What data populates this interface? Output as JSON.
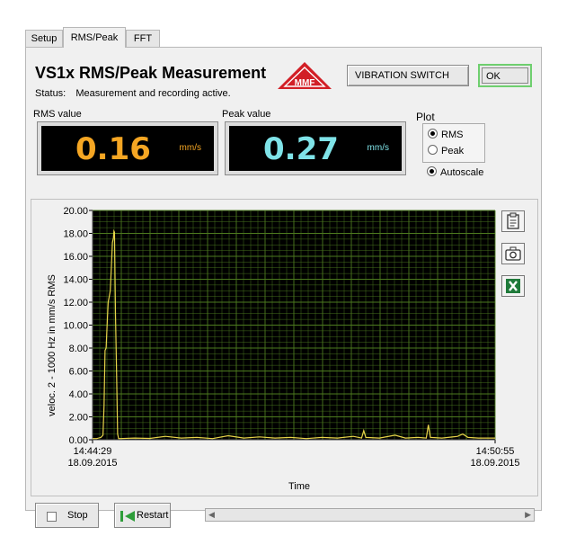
{
  "tabs": [
    {
      "label": "Setup",
      "active": false
    },
    {
      "label": "RMS/Peak",
      "active": true
    },
    {
      "label": "FFT",
      "active": false
    }
  ],
  "header": {
    "title": "VS1x RMS/Peak Measurement",
    "status_label": "Status:",
    "status_text": "Measurement and recording active.",
    "logo_text": "MMF",
    "vibration_switch_label": "VIBRATION SWITCH",
    "ok_label": "OK"
  },
  "rms": {
    "label": "RMS value",
    "value": "0.16",
    "unit": "mm/s",
    "color": "#f5a623"
  },
  "peak": {
    "label": "Peak value",
    "value": "0.27",
    "unit": "mm/s",
    "color": "#7fe3e8"
  },
  "plot": {
    "label": "Plot",
    "options": [
      {
        "label": "RMS",
        "selected": true
      },
      {
        "label": "Peak",
        "selected": false
      }
    ],
    "autoscale_label": "Autoscale",
    "autoscale_checked": true
  },
  "chart_data": {
    "type": "line",
    "xlabel": "Time",
    "ylabel": "veloc. 2 - 1000 Hz in mm/s RMS",
    "ylim": [
      0,
      20
    ],
    "yticks": [
      "0.00",
      "2.00",
      "4.00",
      "6.00",
      "8.00",
      "10.00",
      "12.00",
      "14.00",
      "16.00",
      "18.00",
      "20.00"
    ],
    "xticks": [
      {
        "time": "14:44:29",
        "date": "18.09.2015"
      },
      {
        "time": "14:50:55",
        "date": "18.09.2015"
      }
    ],
    "xlim_seconds": [
      0,
      386
    ],
    "grid": true,
    "colors": {
      "background": "#000000",
      "grid": "#4d7a1f",
      "line": "#e8d44a"
    },
    "series": [
      {
        "values": [
          [
            0,
            0.1
          ],
          [
            4,
            0.1
          ],
          [
            8,
            0.2
          ],
          [
            10,
            0.4
          ],
          [
            11,
            3
          ],
          [
            12,
            7.8
          ],
          [
            13,
            8.0
          ],
          [
            14,
            10
          ],
          [
            15,
            12
          ],
          [
            16,
            12.5
          ],
          [
            17,
            13
          ],
          [
            18,
            15
          ],
          [
            19,
            17.2
          ],
          [
            20,
            17.6
          ],
          [
            20.5,
            18.2
          ],
          [
            21,
            18.1
          ],
          [
            22,
            11
          ],
          [
            23,
            6
          ],
          [
            24,
            0.5
          ],
          [
            25,
            0.1
          ],
          [
            26,
            0.1
          ],
          [
            40,
            0.15
          ],
          [
            55,
            0.12
          ],
          [
            70,
            0.3
          ],
          [
            85,
            0.15
          ],
          [
            100,
            0.2
          ],
          [
            115,
            0.1
          ],
          [
            130,
            0.35
          ],
          [
            145,
            0.15
          ],
          [
            160,
            0.25
          ],
          [
            175,
            0.15
          ],
          [
            190,
            0.2
          ],
          [
            205,
            0.1
          ],
          [
            220,
            0.2
          ],
          [
            235,
            0.15
          ],
          [
            250,
            0.3
          ],
          [
            258,
            0.15
          ],
          [
            260,
            0.8
          ],
          [
            262,
            0.2
          ],
          [
            275,
            0.15
          ],
          [
            290,
            0.4
          ],
          [
            300,
            0.15
          ],
          [
            312,
            0.2
          ],
          [
            320,
            0.15
          ],
          [
            322,
            1.3
          ],
          [
            324,
            0.2
          ],
          [
            335,
            0.15
          ],
          [
            350,
            0.3
          ],
          [
            355,
            0.5
          ],
          [
            360,
            0.2
          ],
          [
            370,
            0.15
          ],
          [
            386,
            0.15
          ]
        ]
      }
    ]
  },
  "icons": {
    "clipboard": "clipboard-icon",
    "camera": "camera-icon",
    "excel": "excel-icon",
    "restart": "restart-icon"
  },
  "footer": {
    "stop_label": "Stop",
    "restart_label": "Restart"
  }
}
